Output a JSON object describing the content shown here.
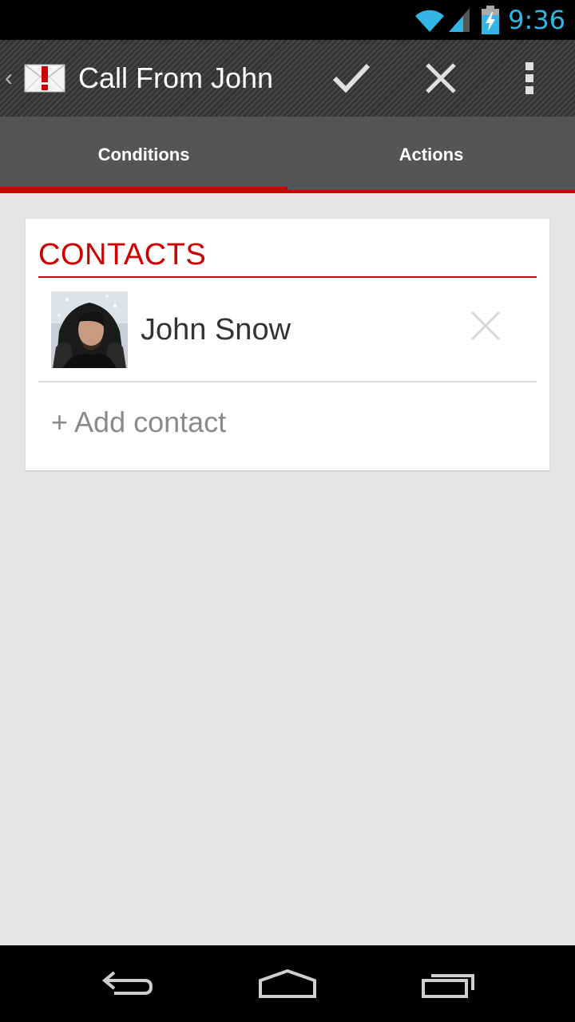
{
  "status_bar": {
    "time": "9:36",
    "icons": [
      "wifi-icon",
      "signal-icon",
      "battery-charging-icon"
    ]
  },
  "action_bar": {
    "title": "Call From John",
    "app_icon": "envelope-alert-icon",
    "actions": [
      "check-icon",
      "close-icon",
      "overflow-menu-icon"
    ]
  },
  "tabs": [
    {
      "label": "Conditions",
      "selected": true
    },
    {
      "label": "Actions",
      "selected": false
    }
  ],
  "contacts_card": {
    "header": "CONTACTS",
    "contacts": [
      {
        "name": "John Snow",
        "avatar": "contact-photo"
      }
    ],
    "add_label": "+ Add contact"
  },
  "nav_bar": {
    "buttons": [
      "back-icon",
      "home-icon",
      "recents-icon"
    ]
  },
  "colors": {
    "accent": "#cc0000",
    "status_time": "#33b5e5",
    "tab_bar": "#555555",
    "background": "#e5e5e5"
  }
}
